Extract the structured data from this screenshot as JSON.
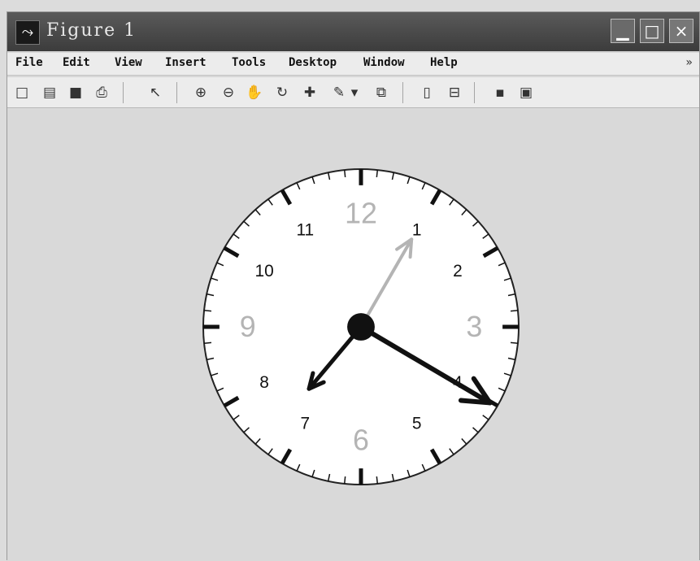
{
  "window": {
    "title": "Figure 1"
  },
  "titlebar": {
    "icon_glyph": "⤳",
    "min_glyph": "▁",
    "max_glyph": "□",
    "close_glyph": "×"
  },
  "menu": {
    "items": [
      "File",
      "Edit",
      "View",
      "Insert",
      "Tools",
      "Desktop",
      "Window",
      "Help"
    ],
    "more_glyph": "»"
  },
  "toolbar": {
    "icons": [
      {
        "name": "new-figure-icon",
        "glyph": "□"
      },
      {
        "name": "open-file-icon",
        "glyph": "▤"
      },
      {
        "name": "save-icon",
        "glyph": "■"
      },
      {
        "name": "print-icon",
        "glyph": "⎙"
      },
      {
        "name": "pointer-icon",
        "glyph": "↖"
      },
      {
        "name": "zoom-in-icon",
        "glyph": "⊕"
      },
      {
        "name": "zoom-out-icon",
        "glyph": "⊖"
      },
      {
        "name": "pan-hand-icon",
        "glyph": "✋"
      },
      {
        "name": "rotate-3d-icon",
        "glyph": "↻"
      },
      {
        "name": "data-cursor-icon",
        "glyph": "✚"
      },
      {
        "name": "brush-icon",
        "glyph": "✎"
      },
      {
        "name": "brush-dropdown-icon",
        "glyph": "▾"
      },
      {
        "name": "link-plot-icon",
        "glyph": "⧉"
      },
      {
        "name": "colorbar-icon",
        "glyph": "▯"
      },
      {
        "name": "legend-icon",
        "glyph": "⊟"
      },
      {
        "name": "hide-plot-tools-icon",
        "glyph": "▪"
      },
      {
        "name": "show-plot-tools-icon",
        "glyph": "▣"
      }
    ]
  },
  "clock": {
    "hour_labels": [
      "1",
      "2",
      "3",
      "4",
      "5",
      "6",
      "7",
      "8",
      "9",
      "10",
      "11",
      "12"
    ],
    "highlight_labels": [
      "3",
      "6",
      "9",
      "12"
    ],
    "time": {
      "hour": 7,
      "minute": 20,
      "second": 5
    },
    "colors": {
      "face": "#ffffff",
      "tick": "#111111",
      "label": "#111111",
      "highlight_label": "#b4b4b4",
      "hour_hand": "#111111",
      "minute_hand": "#111111",
      "second_hand": "#b4b4b4"
    }
  }
}
